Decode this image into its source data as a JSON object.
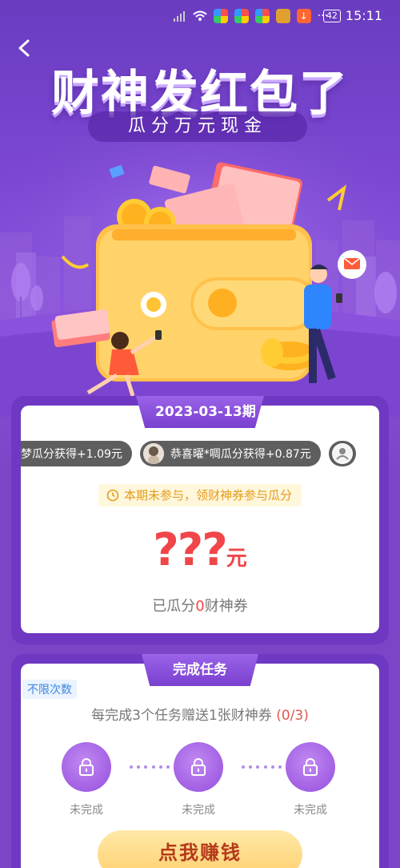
{
  "status_bar": {
    "battery": "42",
    "time": "15:11",
    "more": "···"
  },
  "header": {
    "back_icon": "chevron-left-icon",
    "title": "财神发红包了",
    "subtitle": "瓜分万元现金"
  },
  "period_card": {
    "period_label": "2023-03-13期",
    "ticker": [
      {
        "text": "梦瓜分获得+1.09元",
        "has_avatar": false
      },
      {
        "text": "恭喜曜*啁瓜分获得+0.87元",
        "has_avatar": true
      }
    ],
    "notice": "本期未参与，领财神券参与瓜分",
    "amount": "???",
    "amount_unit": "元",
    "claimed_prefix": "已瓜分",
    "claimed_count": "0",
    "claimed_suffix": "财神券"
  },
  "task_card": {
    "title": "完成任务",
    "tag": "不限次数",
    "desc": "每完成3个任务赠送张财神券",
    "desc_main": "每完成3个任务赠送1张财神券",
    "progress": "(0/3)",
    "steps": [
      {
        "label": "未完成"
      },
      {
        "label": "未完成"
      },
      {
        "label": "未完成"
      }
    ],
    "cta": "点我赚钱"
  },
  "colors": {
    "bg_purple": "#7a45c6",
    "accent_red": "#f0464a",
    "notice_orange": "#e49b1a",
    "cta_gold": "#ffcf6e"
  }
}
